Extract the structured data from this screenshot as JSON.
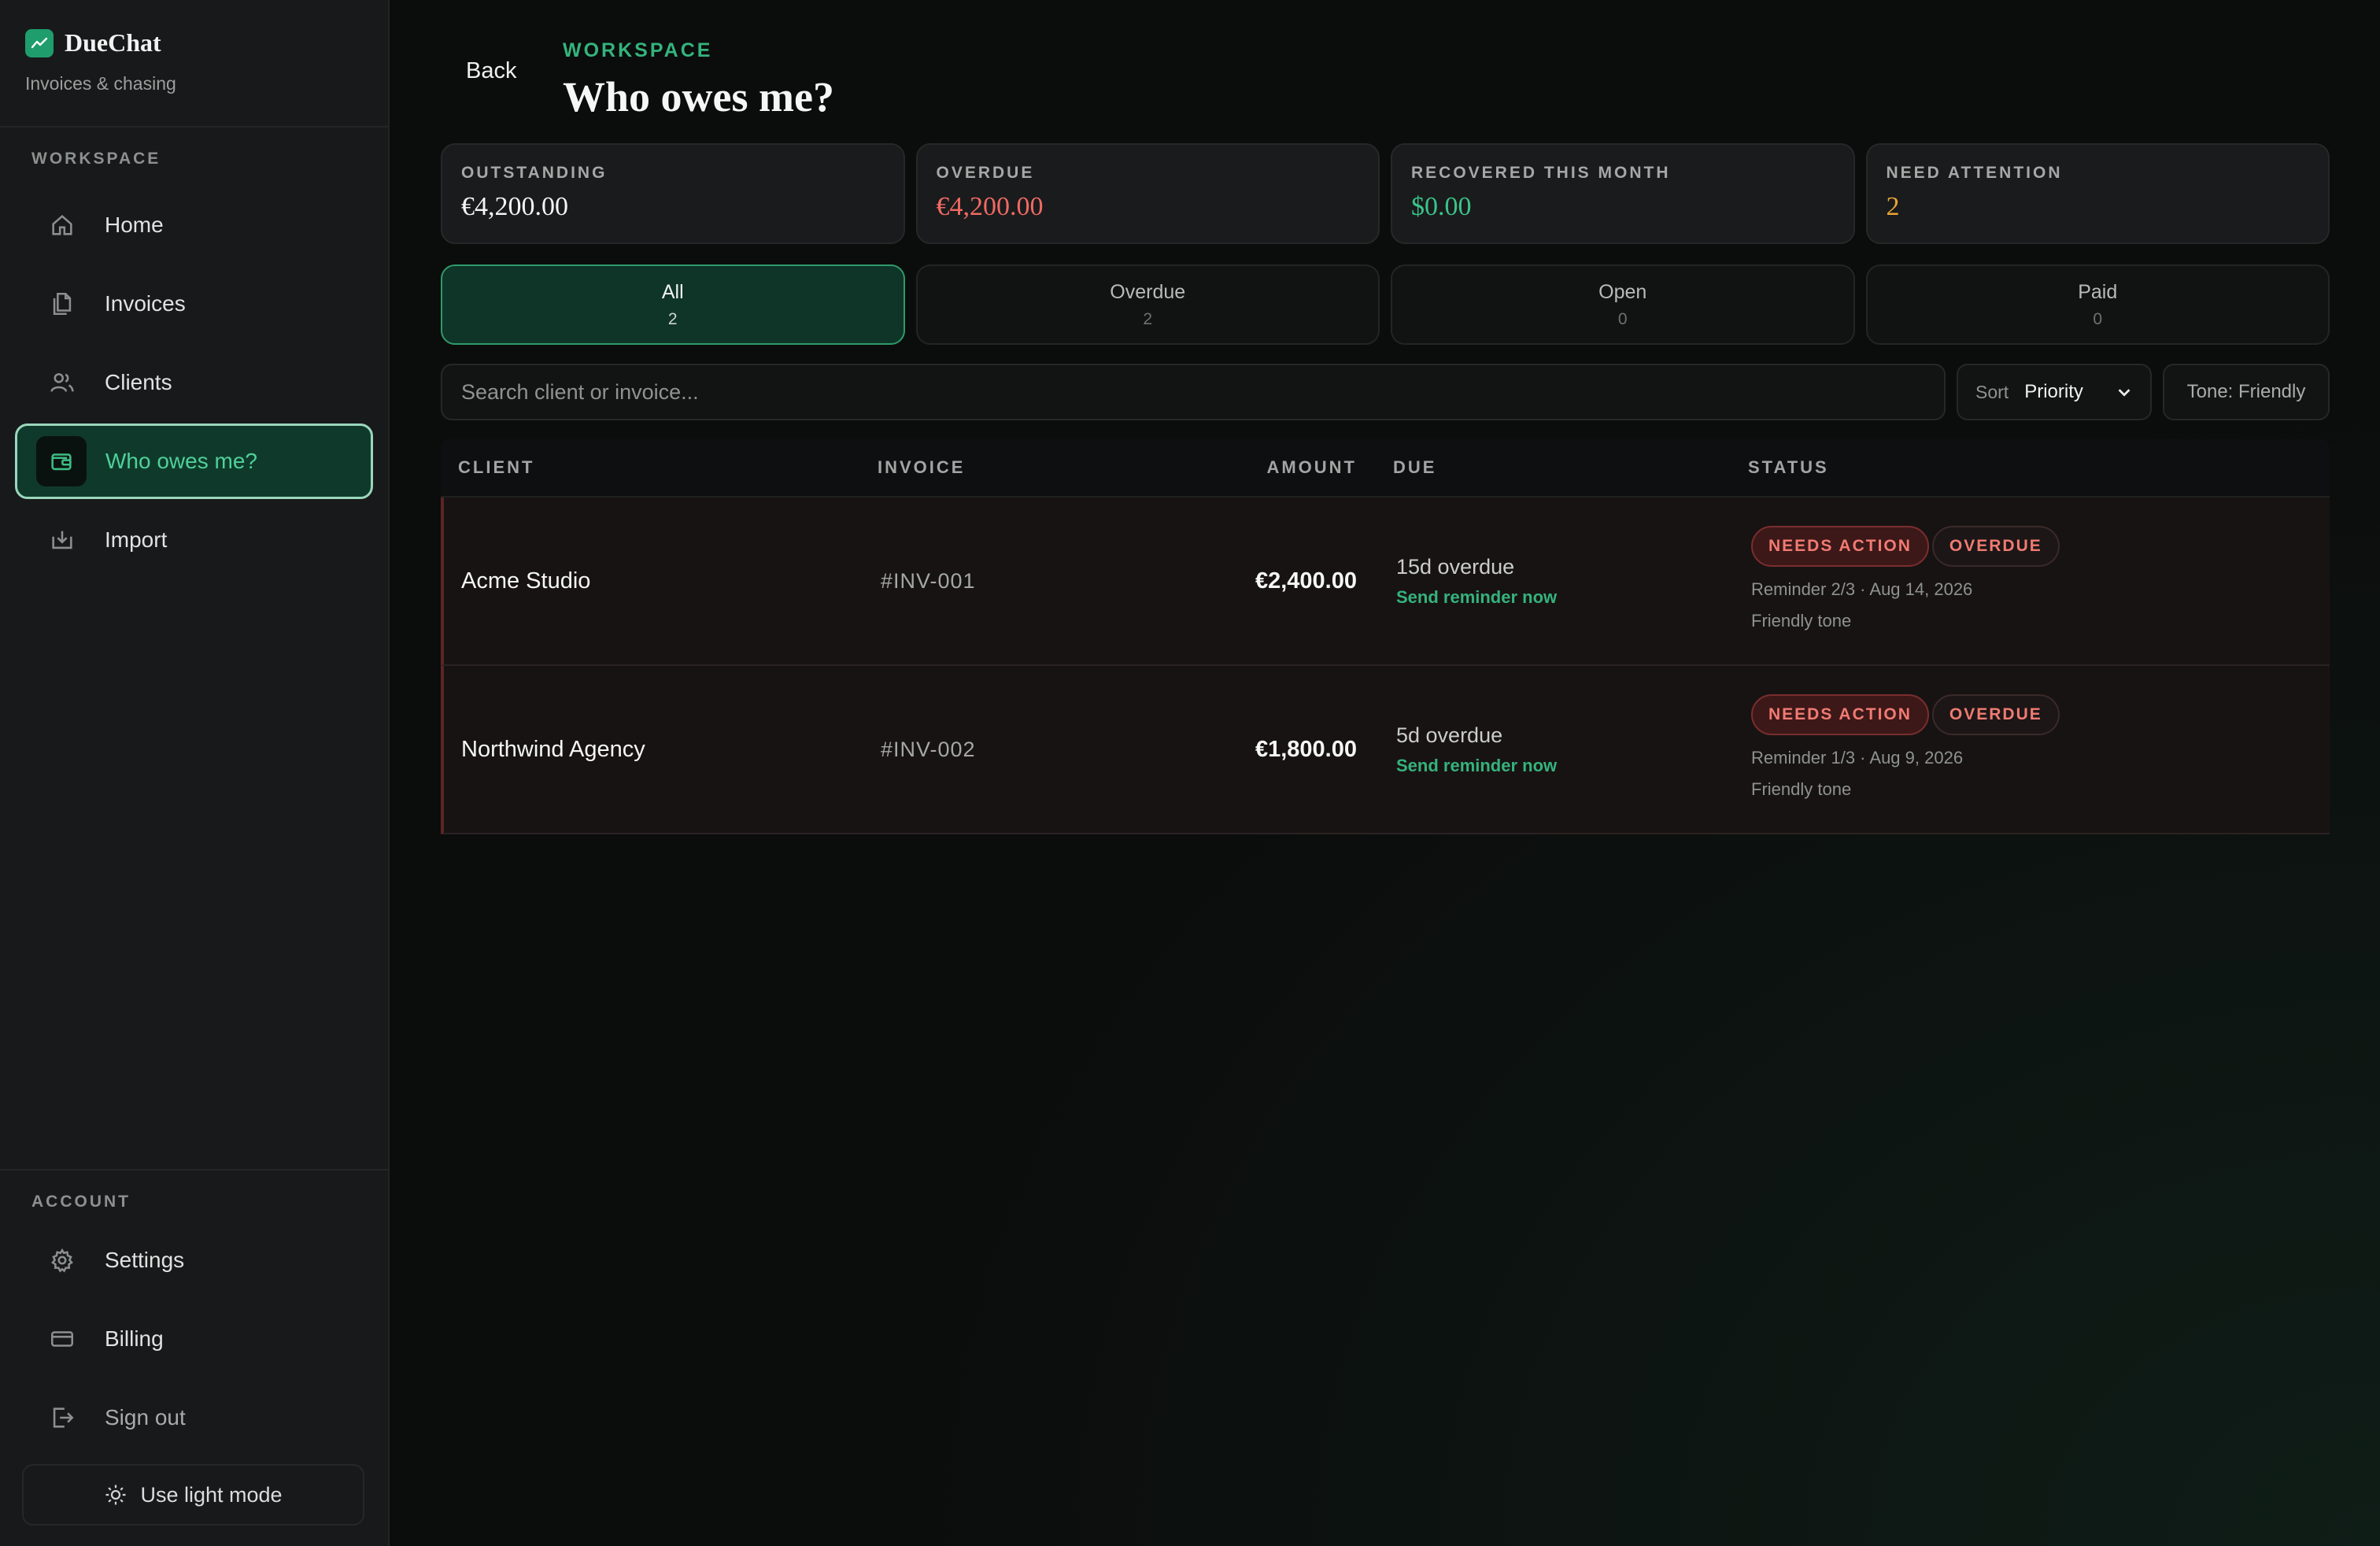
{
  "brand": {
    "name": "DueChat",
    "subtitle": "Invoices & chasing"
  },
  "sidebar": {
    "workspace_label": "WORKSPACE",
    "items": [
      {
        "label": "Home",
        "icon": "home-icon"
      },
      {
        "label": "Invoices",
        "icon": "documents-icon"
      },
      {
        "label": "Clients",
        "icon": "users-icon"
      },
      {
        "label": "Who owes me?",
        "icon": "wallet-icon",
        "active": true
      },
      {
        "label": "Import",
        "icon": "import-icon"
      }
    ],
    "account_label": "ACCOUNT",
    "account_items": [
      {
        "label": "Settings",
        "icon": "gear-icon"
      },
      {
        "label": "Billing",
        "icon": "credit-card-icon"
      },
      {
        "label": "Sign out",
        "icon": "sign-out-icon"
      }
    ],
    "light_mode_label": "Use light mode"
  },
  "header": {
    "back_label": "Back",
    "crumb": "WORKSPACE",
    "title": "Who owes me?"
  },
  "stats": [
    {
      "label": "OUTSTANDING",
      "value": "€4,200.00",
      "tone": "default"
    },
    {
      "label": "OVERDUE",
      "value": "€4,200.00",
      "tone": "red"
    },
    {
      "label": "RECOVERED THIS MONTH",
      "value": "$0.00",
      "tone": "green"
    },
    {
      "label": "NEED ATTENTION",
      "value": "2",
      "tone": "amber"
    }
  ],
  "tabs": [
    {
      "label": "All",
      "count": "2",
      "active": true
    },
    {
      "label": "Overdue",
      "count": "2"
    },
    {
      "label": "Open",
      "count": "0"
    },
    {
      "label": "Paid",
      "count": "0"
    }
  ],
  "toolbar": {
    "search_placeholder": "Search client or invoice...",
    "sort_label": "Sort",
    "sort_value": "Priority",
    "tone_label": "Tone: Friendly"
  },
  "table": {
    "headers": {
      "client": "CLIENT",
      "invoice": "INVOICE",
      "amount": "AMOUNT",
      "due": "DUE",
      "status": "STATUS"
    },
    "rows": [
      {
        "client": "Acme Studio",
        "invoice": "#INV-001",
        "amount": "€2,400.00",
        "due": "15d overdue",
        "action": "Send reminder now",
        "badge_action": "NEEDS ACTION",
        "badge_status": "OVERDUE",
        "reminder": "Reminder 2/3 · Aug 14, 2026",
        "tone": "Friendly tone"
      },
      {
        "client": "Northwind Agency",
        "invoice": "#INV-002",
        "amount": "€1,800.00",
        "due": "5d overdue",
        "action": "Send reminder now",
        "badge_action": "NEEDS ACTION",
        "badge_status": "OVERDUE",
        "reminder": "Reminder 1/3 · Aug 9, 2026",
        "tone": "Friendly tone"
      }
    ]
  },
  "colors": {
    "accent": "#34b37c",
    "danger": "#f06a64",
    "warning": "#e8a435"
  }
}
